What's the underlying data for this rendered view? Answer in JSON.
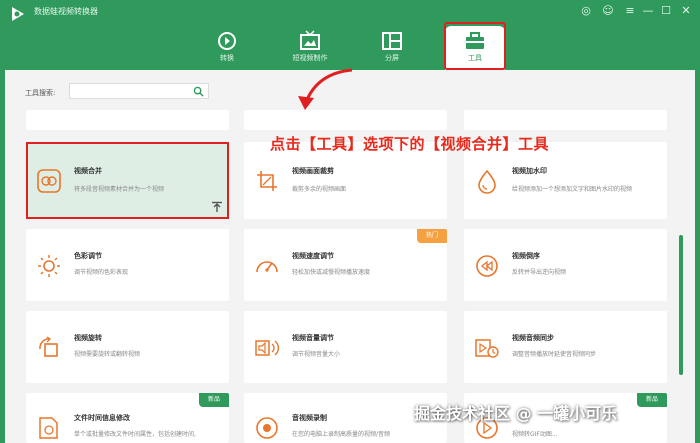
{
  "window": {
    "title": "数据蛙视频转换器",
    "controls": [
      "chat-icon",
      "user-icon",
      "menu-icon",
      "minimize-icon",
      "maximize-icon",
      "close-icon"
    ]
  },
  "nav": {
    "tabs": [
      {
        "label": "转换",
        "icon": "convert-icon"
      },
      {
        "label": "短视频制作",
        "icon": "tv-icon"
      },
      {
        "label": "分屏",
        "icon": "split-screen-icon"
      },
      {
        "label": "工具",
        "icon": "toolbox-icon",
        "active": true
      }
    ]
  },
  "search": {
    "label": "工具搜索:",
    "value": "",
    "placeholder": ""
  },
  "instruction": "点击【工具】选项下的【视频合并】工具",
  "tools": [
    {
      "title": "视频合并",
      "desc": "将多段音视频素材合并为一个视频",
      "icon": "merge-icon",
      "selected": true
    },
    {
      "title": "视频画面裁剪",
      "desc": "裁剪多余的视频画面",
      "icon": "crop-icon"
    },
    {
      "title": "视频加水印",
      "desc": "给视频添加一个想添加文字和图片水印的视频",
      "icon": "watermark-icon"
    },
    {
      "title": "色彩调节",
      "desc": "调节视频的色彩表现",
      "icon": "color-adjust-icon"
    },
    {
      "title": "视频速度调节",
      "desc": "轻松加快或减慢视频播放速度",
      "icon": "speed-icon",
      "badge": "热门"
    },
    {
      "title": "视频倒序",
      "desc": "反转并导出逆向视频",
      "icon": "rewind-icon"
    },
    {
      "title": "视频旋转",
      "desc": "视频需要旋转或翻转视频",
      "icon": "rotate-icon"
    },
    {
      "title": "视频音量调节",
      "desc": "调节视频音量大小",
      "icon": "volume-icon"
    },
    {
      "title": "视频音频同步",
      "desc": "调整音频播放时延使音视频同步",
      "icon": "sync-icon"
    },
    {
      "title": "文件时间信息修改",
      "desc": "单个或批量修改文件时间属性，包括创建时间,",
      "icon": "file-time-icon",
      "badge": "新品"
    },
    {
      "title": "音视频录制",
      "desc": "在您的电脑上录制高质量的视频/音频",
      "icon": "record-icon"
    },
    {
      "title": "",
      "desc": "视频转GIF动图...",
      "icon": "gif-icon",
      "badge": "新品"
    }
  ],
  "watermark": "掘金技术社区 @ 一罐小可乐",
  "colors": {
    "brand": "#2f9a5c",
    "annotation": "#e02020",
    "hot": "#f5a142"
  }
}
